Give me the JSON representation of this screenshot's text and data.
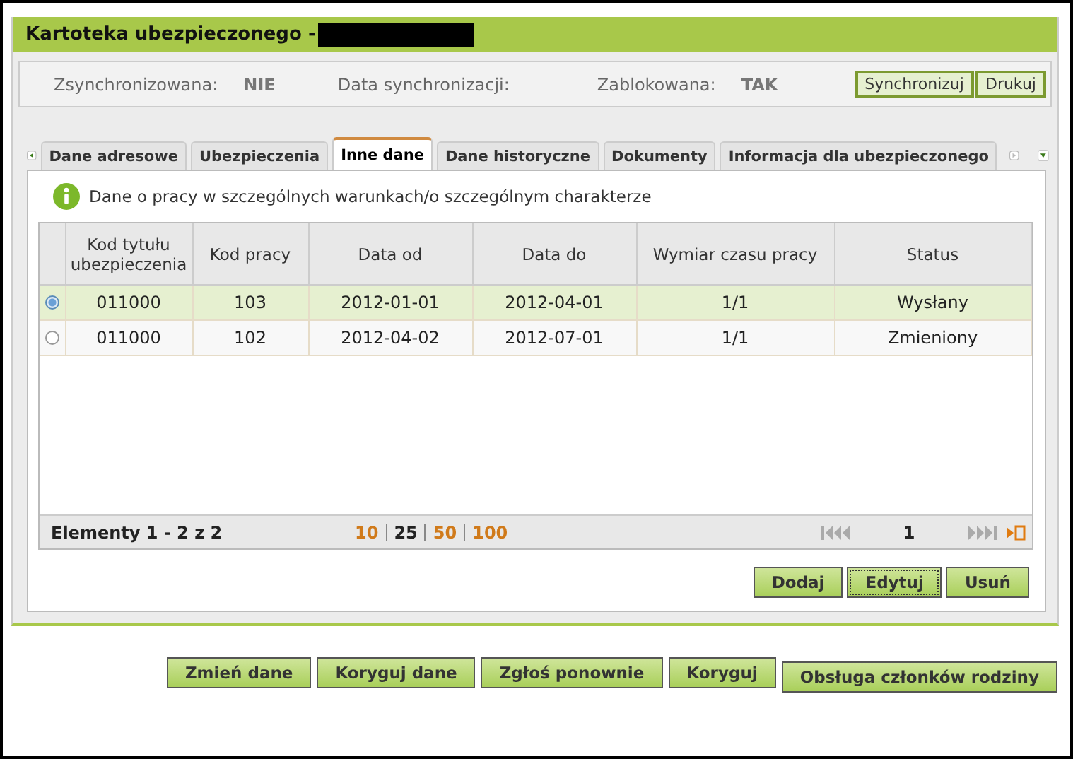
{
  "window": {
    "title": "Kartoteka ubezpieczonego -"
  },
  "sync_bar": {
    "fields": [
      {
        "label": "Zsynchronizowana:",
        "value": "NIE"
      },
      {
        "label": "Data synchronizacji:"
      },
      {
        "label": "Zablokowana:",
        "value": "TAK"
      }
    ],
    "buttons": [
      "Synchronizuj",
      "Drukuj"
    ]
  },
  "tabs": [
    {
      "label": "Dane adresowe",
      "selected": false
    },
    {
      "label": "Ubezpieczenia",
      "selected": false
    },
    {
      "label": "Inne dane",
      "selected": true
    },
    {
      "label": "Dane historyczne",
      "selected": false
    },
    {
      "label": "Dokumenty",
      "selected": false
    },
    {
      "label": "Informacja dla ubezpieczonego",
      "selected": false
    }
  ],
  "section": {
    "title": "Dane o pracy w szczególnych warunkach/o szczególnym charakterze"
  },
  "table": {
    "columns": [
      "Kod tytułu ubezpieczenia",
      "Kod pracy",
      "Data od",
      "Data do",
      "Wymiar czasu pracy",
      "Status"
    ],
    "rows": [
      {
        "selected": true,
        "cells": [
          "011000",
          "103",
          "2012-01-01",
          "2012-04-01",
          "1/1",
          "Wysłany"
        ]
      },
      {
        "selected": false,
        "cells": [
          "011000",
          "102",
          "2012-04-02",
          "2012-07-01",
          "1/1",
          "Zmieniony"
        ]
      }
    ]
  },
  "pager": {
    "summary": "Elementy 1 - 2 z 2",
    "page_sizes": [
      {
        "label": "10",
        "selected": false
      },
      {
        "label": "25",
        "selected": true
      },
      {
        "label": "50",
        "selected": false
      },
      {
        "label": "100",
        "selected": false
      }
    ],
    "page": "1"
  },
  "table_buttons": [
    {
      "label": "Dodaj",
      "focused": false
    },
    {
      "label": "Edytuj",
      "focused": true
    },
    {
      "label": "Usuń",
      "focused": false
    }
  ],
  "footer_buttons": [
    "Zmień dane",
    "Koryguj dane",
    "Zgłoś ponownie",
    "Koryguj",
    "Obsługa członków rodziny"
  ]
}
